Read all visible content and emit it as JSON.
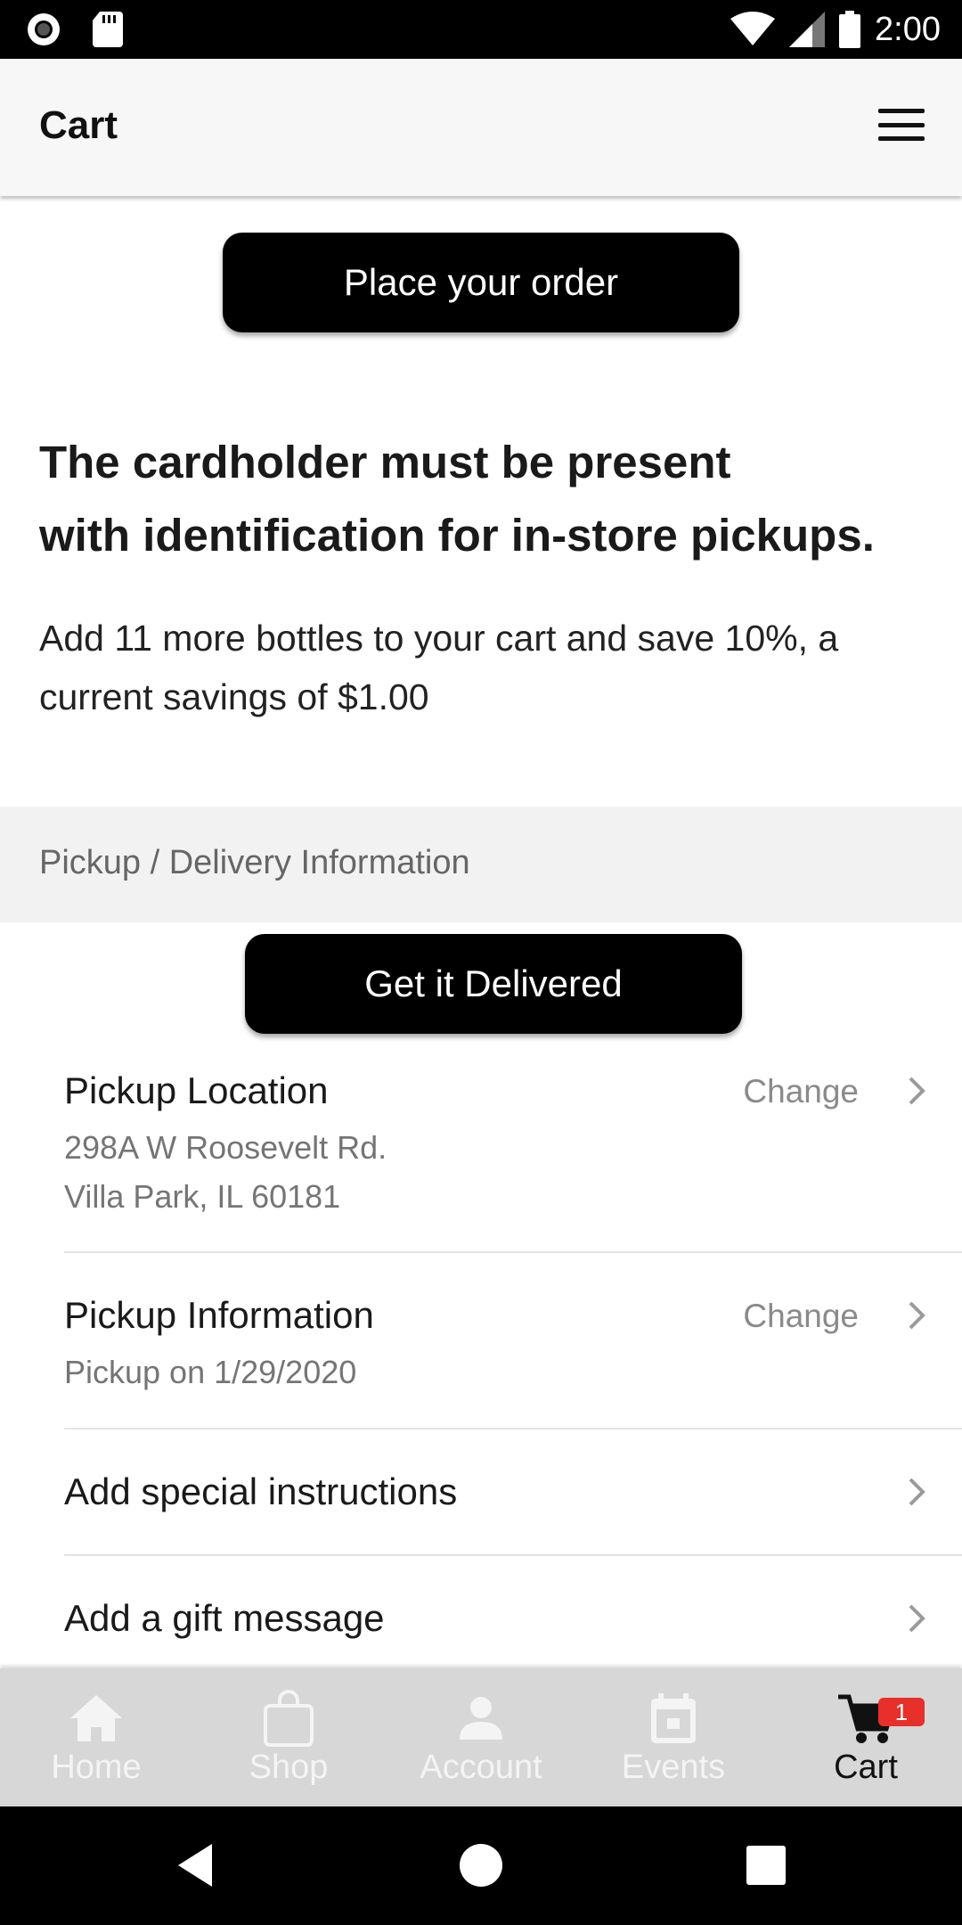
{
  "status_bar": {
    "time": "2:00",
    "left_icons": [
      "record-icon",
      "sd-card-icon"
    ],
    "right_icons": [
      "wifi-icon",
      "cell-signal-icon",
      "battery-icon"
    ]
  },
  "header": {
    "title": "Cart",
    "menu_icon": "hamburger-menu-icon"
  },
  "main": {
    "place_order_label": "Place your order",
    "notice_line1": "The cardholder must be present",
    "notice_line2": "with identification for in-store pickups.",
    "savings_line1": "Add 11 more bottles to your cart and save 10%, a",
    "savings_line2": "current savings of $1.00",
    "section_title": "Pickup / Delivery Information",
    "delivered_label": "Get it Delivered",
    "pickup_location": {
      "title": "Pickup Location",
      "address_line1": "298A W Roosevelt Rd.",
      "address_line2": "Villa Park, IL 60181",
      "action": "Change"
    },
    "pickup_information": {
      "title": "Pickup Information",
      "detail": "Pickup on 1/29/2020",
      "action": "Change"
    },
    "special_instructions": "Add special instructions",
    "gift_message": "Add a gift message"
  },
  "bottom_nav": {
    "items": [
      {
        "label": "Home",
        "icon": "home-icon"
      },
      {
        "label": "Shop",
        "icon": "shopping-bag-icon"
      },
      {
        "label": "Account",
        "icon": "person-icon"
      },
      {
        "label": "Events",
        "icon": "calendar-icon"
      },
      {
        "label": "Cart",
        "icon": "cart-icon",
        "active": true
      }
    ],
    "cart_badge": "1"
  },
  "colors": {
    "accent": "#000000",
    "badge": "#e8302a",
    "nav_background": "#d7d7d7",
    "section_band": "#f2f2f2"
  }
}
